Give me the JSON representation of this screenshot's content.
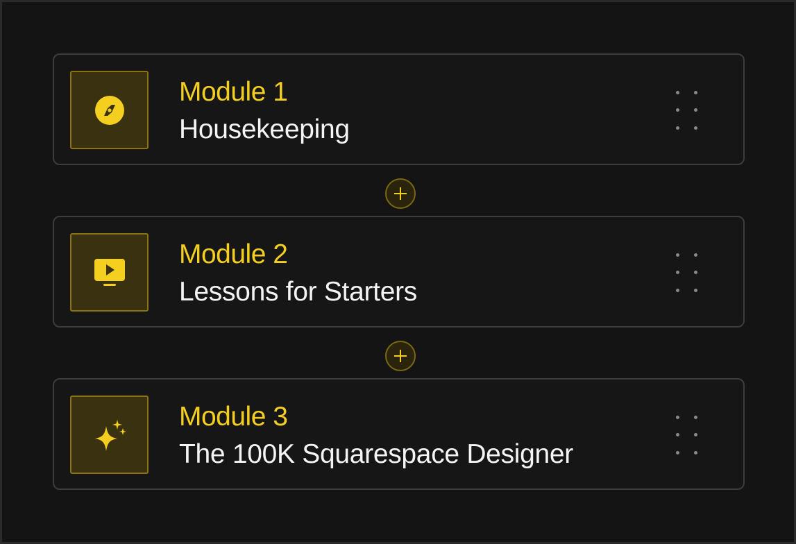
{
  "colors": {
    "accent": "#f5cf1f",
    "background": "#141414",
    "card_border": "#3d3d3d",
    "text": "#f4f4f4"
  },
  "modules": [
    {
      "label": "Module 1",
      "title": "Housekeeping",
      "icon": "compass-icon"
    },
    {
      "label": "Module 2",
      "title": "Lessons for Starters",
      "icon": "play-screen-icon"
    },
    {
      "label": "Module 3",
      "title": "The 100K Squarespace Designer",
      "icon": "sparkle-icon"
    }
  ],
  "add_buttons": [
    {
      "icon": "plus-icon"
    },
    {
      "icon": "plus-icon"
    }
  ]
}
